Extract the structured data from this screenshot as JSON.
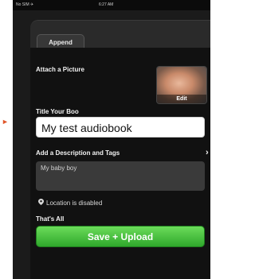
{
  "status_bar": {
    "carrier": "No SIM ✈",
    "time": "6:27 AM",
    "battery": ""
  },
  "nav": {
    "append_label": "Append"
  },
  "attach": {
    "label": "Attach a Picture",
    "edit_label": "Edit"
  },
  "title": {
    "label": "Title Your Boo",
    "value": "My test audiobook"
  },
  "description": {
    "label": "Add a Description and Tags",
    "value": "My baby boy"
  },
  "location": {
    "text": "Location is disabled"
  },
  "footer": {
    "label": "That's All",
    "save_label": "Save + Upload"
  },
  "colors": {
    "save_button": "#3cbf36",
    "background": "#111111"
  }
}
